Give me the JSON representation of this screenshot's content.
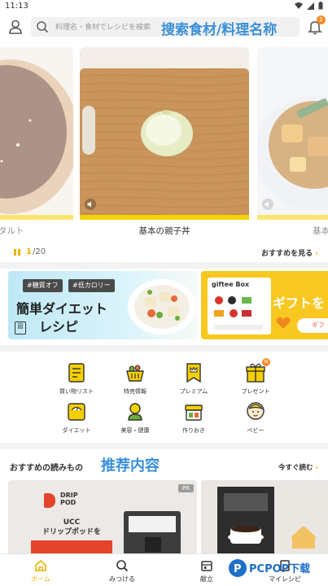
{
  "status": {
    "time": "11:13"
  },
  "header": {
    "search_placeholder": "料理名・食材でレシピを検索",
    "search_overlay": "搜索食材/料理名称",
    "notification_count": "2"
  },
  "carousel": {
    "cards": [
      {
        "title": "タルト"
      },
      {
        "title": "基本の親子丼"
      },
      {
        "title": "基本"
      }
    ],
    "page_current": "1",
    "page_total": "/20",
    "see_more": "おすすめを見る"
  },
  "banners": {
    "diet": {
      "tag1": "#糖質オフ",
      "tag2": "#低カロリー",
      "title_line1": "簡単ダイエット",
      "title_line2": "レシピ",
      "logo_mark": "図"
    },
    "gift": {
      "brand": "giftee Box",
      "text": "ギフトを",
      "pill": "ギフ"
    }
  },
  "categories": [
    {
      "label": "買い物リスト",
      "icon": "shopping-list-icon"
    },
    {
      "label": "特売情報",
      "icon": "sale-basket-icon"
    },
    {
      "label": "プレミアム",
      "icon": "premium-crown-icon"
    },
    {
      "label": "プレゼント",
      "icon": "present-icon",
      "badge": "N"
    },
    {
      "label": "ダイエット",
      "icon": "scale-icon"
    },
    {
      "label": "美容・健康",
      "icon": "beauty-health-icon"
    },
    {
      "label": "作りおき",
      "icon": "lunchbox-icon"
    },
    {
      "label": "ベビー",
      "icon": "baby-icon"
    }
  ],
  "reads": {
    "title": "おすすめの読みもの",
    "overlay": "推荐内容",
    "more": "今すぐ読む",
    "article1": {
      "drip_line1": "DRIP",
      "drip_line2": "POD",
      "ucc_line1": "UCC",
      "ucc_line2": "ドリップポッドを",
      "pr": "PR"
    }
  },
  "nav": [
    {
      "label": "ホーム",
      "icon": "home-icon",
      "active": true
    },
    {
      "label": "みつける",
      "icon": "search-icon"
    },
    {
      "label": "献立",
      "icon": "menu-plan-icon"
    },
    {
      "label": "マイレシピ",
      "icon": "my-recipe-icon"
    }
  ],
  "watermark": {
    "text": "PCPOP下载"
  },
  "colors": {
    "accent": "#f5d000",
    "overlay_blue": "#3a8fd8",
    "badge_orange": "#f28c28"
  }
}
